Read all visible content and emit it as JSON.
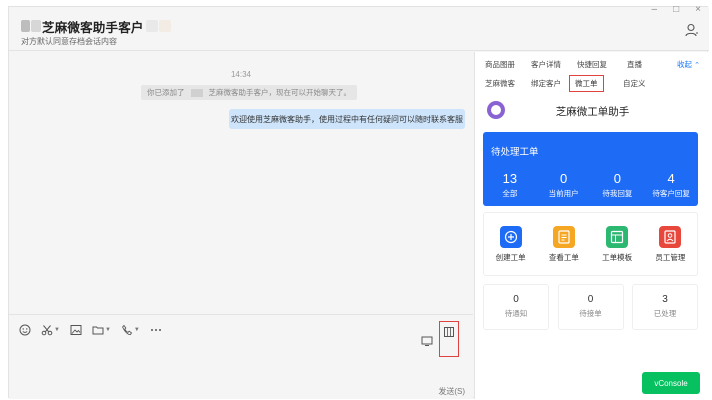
{
  "window": {
    "title": "芝麻微客助手客户",
    "subtitle": "对方默认同意存档会话内容",
    "controls": {
      "minimize": "–",
      "maximize": "□",
      "close": "×"
    }
  },
  "chat": {
    "timestamp": "14:34",
    "system_message": {
      "prefix": "你已添加了",
      "text": "芝麻微客助手客户，现在可以开始聊天了。"
    },
    "sent_message": "欢迎使用芝麻微客助手，使用过程中有任何疑问可以随时联系客服"
  },
  "input": {
    "send_label": "发送(S)",
    "toolbar_icons": [
      "emoji-icon",
      "scissors-icon",
      "image-icon",
      "folder-icon",
      "phone-icon",
      "more-icon"
    ]
  },
  "panel": {
    "tabs_row1": [
      "商品图册",
      "客户详情",
      "快捷回复",
      "直播"
    ],
    "collapse_label": "收起",
    "tabs_row2": [
      "芝麻微客",
      "绑定客户",
      "微工单",
      "自定义"
    ],
    "bot_name": "芝麻微工单助手",
    "pending": {
      "title": "待处理工单",
      "stats": [
        {
          "value": "13",
          "label": "全部"
        },
        {
          "value": "0",
          "label": "当前用户"
        },
        {
          "value": "0",
          "label": "待我回复"
        },
        {
          "value": "4",
          "label": "待客户回复"
        }
      ]
    },
    "functions": [
      {
        "label": "创建工单",
        "color": "#1e6bf5"
      },
      {
        "label": "查看工单",
        "color": "#f5a623"
      },
      {
        "label": "工单模板",
        "color": "#2db872"
      },
      {
        "label": "员工管理",
        "color": "#e8483b"
      }
    ],
    "bottom_stats": [
      {
        "value": "0",
        "label": "待通知"
      },
      {
        "value": "0",
        "label": "待接单"
      },
      {
        "value": "3",
        "label": "已处理"
      }
    ]
  },
  "vconsole_label": "vConsole"
}
